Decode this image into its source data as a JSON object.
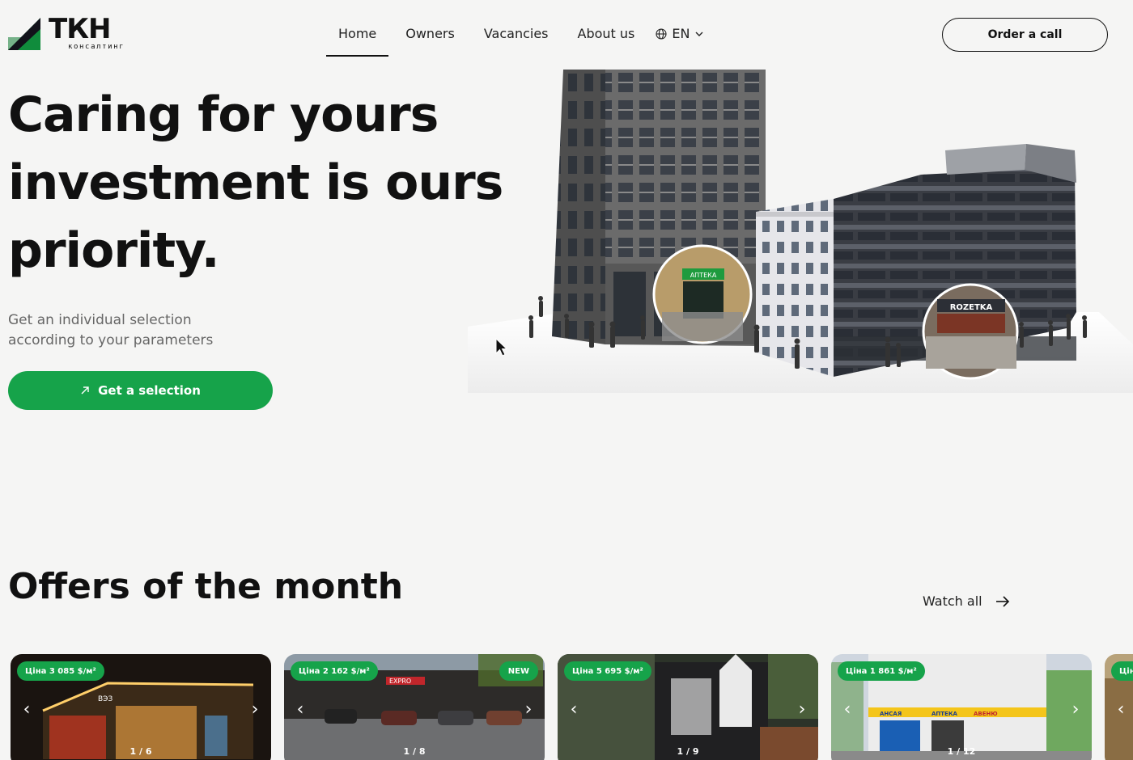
{
  "header": {
    "brand": "ТКН",
    "brand_sub": "консалтинг",
    "nav": [
      {
        "label": "Home",
        "active": true
      },
      {
        "label": "Owners",
        "active": false
      },
      {
        "label": "Vacancies",
        "active": false
      },
      {
        "label": "About us",
        "active": false
      }
    ],
    "language": "EN",
    "order_button": "Order a call"
  },
  "hero": {
    "title_line1": "Caring for yours",
    "title_line2": "investment is ours",
    "title_line3": "priority.",
    "subtitle_line1": "Get an individual selection",
    "subtitle_line2": "according to your parameters",
    "cta_label": "Get a selection",
    "pharmacy_sign": "АПТЕКА",
    "store_sign": "ROZETKA"
  },
  "offers": {
    "title": "Offers of the month",
    "watch_all": "Watch all",
    "cards": [
      {
        "price": "Ціна 3 085 $/м²",
        "new": false,
        "counter": "1 / 6",
        "sign": "ВЭЗ"
      },
      {
        "price": "Ціна 2 162 $/м²",
        "new": true,
        "new_label": "NEW",
        "counter": "1 / 8",
        "sign": "EXPRO"
      },
      {
        "price": "Ціна 5 695 $/м²",
        "new": false,
        "counter": "1 / 9"
      },
      {
        "price": "Ціна 1 861 $/м²",
        "new": false,
        "counter": "1 / 12",
        "sign_a": "АНСАЯ",
        "sign_b": "АПТЕКА",
        "sign_c": "АВЕНЮ"
      },
      {
        "price": "Ціна",
        "new": false,
        "counter": ""
      }
    ]
  },
  "colors": {
    "accent": "#16a34a",
    "background": "#f5f5f4",
    "text": "#111111"
  },
  "icons": [
    "logo-mark-icon",
    "globe-icon",
    "chevron-down-icon",
    "arrow-up-right-icon",
    "arrow-right-icon",
    "chevron-left-icon",
    "chevron-right-icon"
  ]
}
